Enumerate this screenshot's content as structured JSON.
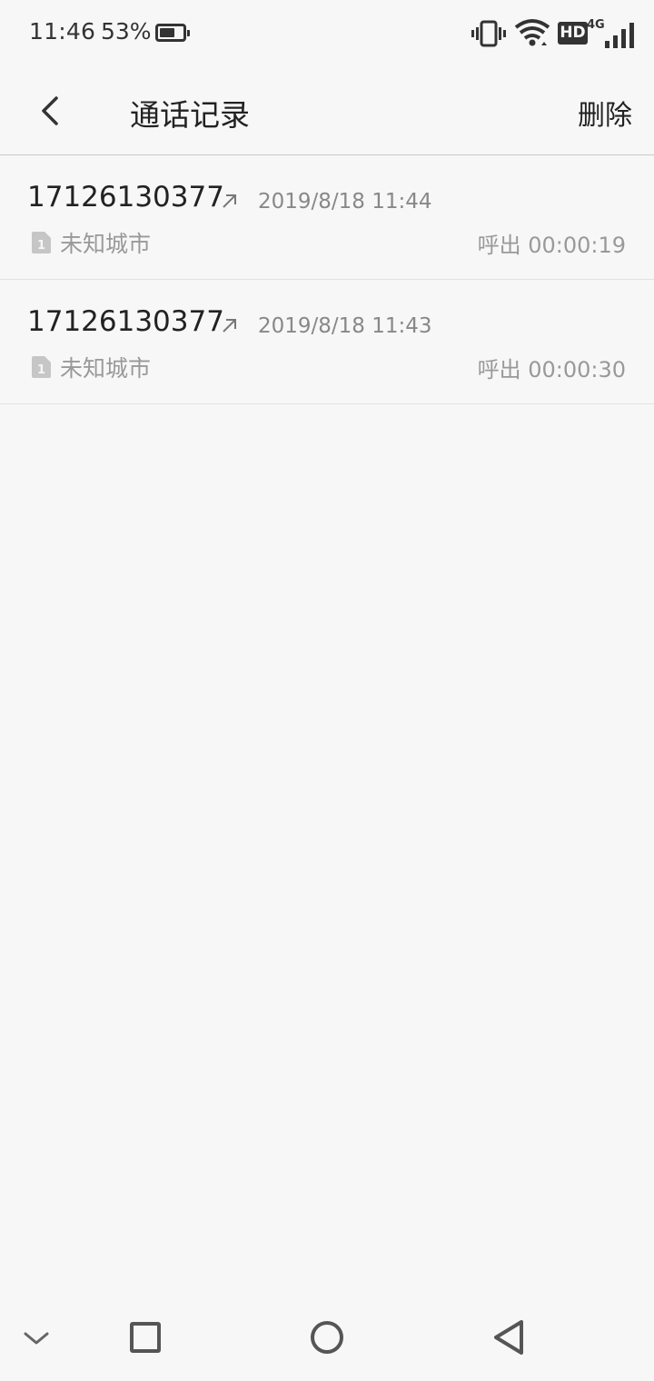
{
  "status_bar": {
    "time": "11:46",
    "battery_percent": "53%",
    "network_badge": "HD",
    "network_type": "4G",
    "icons": [
      "battery-icon",
      "vibrate-icon",
      "wifi-icon",
      "signal-icon"
    ]
  },
  "header": {
    "title": "通话记录",
    "delete_label": "删除",
    "back_icon": "back-chevron-icon"
  },
  "calls": [
    {
      "number": "17126130377",
      "direction_icon": "outgoing-arrow-icon",
      "datetime": "2019/8/18 11:44",
      "sim": "1",
      "location": "未知城市",
      "type_duration": "呼出 00:00:19"
    },
    {
      "number": "17126130377",
      "direction_icon": "outgoing-arrow-icon",
      "datetime": "2019/8/18 11:43",
      "sim": "1",
      "location": "未知城市",
      "type_duration": "呼出 00:00:30"
    }
  ],
  "nav_bar": {
    "icons": [
      "hide-nav-icon",
      "recent-apps-icon",
      "home-icon",
      "back-triangle-icon"
    ]
  },
  "colors": {
    "background": "#f7f7f7",
    "primary_text": "#222222",
    "secondary_text": "#999999",
    "divider": "#e2e2e2"
  }
}
